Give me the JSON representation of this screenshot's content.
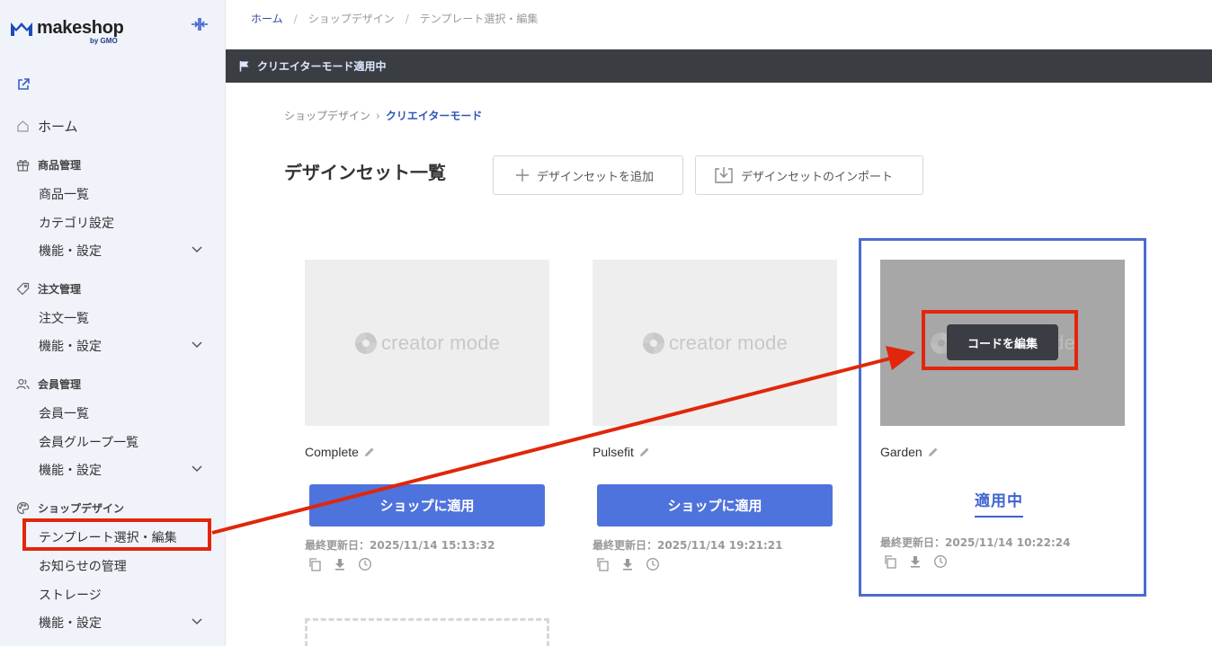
{
  "brand": {
    "name": "makeshop",
    "sub": "by GMO"
  },
  "sidebar": {
    "home": "ホーム",
    "sections": [
      {
        "title": "商品管理",
        "items": [
          "商品一覧",
          "カテゴリ設定",
          "機能・設定"
        ]
      },
      {
        "title": "注文管理",
        "items": [
          "注文一覧",
          "機能・設定"
        ]
      },
      {
        "title": "会員管理",
        "items": [
          "会員一覧",
          "会員グループ一覧",
          "機能・設定"
        ]
      },
      {
        "title": "ショップデザイン",
        "items": [
          "テンプレート選択・編集",
          "お知らせの管理",
          "ストレージ",
          "機能・設定"
        ]
      }
    ]
  },
  "breadcrumb": [
    "ホーム",
    "ショップデザイン",
    "テンプレート選択・編集"
  ],
  "banner": "クリエイターモード適用中",
  "sub_breadcrumb": {
    "parent": "ショップデザイン",
    "current": "クリエイターモード"
  },
  "page_title": "デザインセット一覧",
  "buttons": {
    "add": "デザインセットを追加",
    "import": "デザインセットのインポート"
  },
  "watermark": "creator mode",
  "cards": [
    {
      "name": "Complete",
      "action": "ショップに適用",
      "updated": "最終更新日：2025/11/14 15:13:32"
    },
    {
      "name": "Pulsefit",
      "action": "ショップに適用",
      "updated": "最終更新日：2025/11/14 19:21:21"
    },
    {
      "name": "Garden",
      "status": "適用中",
      "edit_code": "コードを編集",
      "updated": "最終更新日：2025/11/14 10:22:24"
    }
  ],
  "colors": {
    "primary": "#4f73dd",
    "annotation_red": "#e1260b",
    "annotation_blue": "#4d6bd0",
    "banner": "#3a3d42"
  }
}
